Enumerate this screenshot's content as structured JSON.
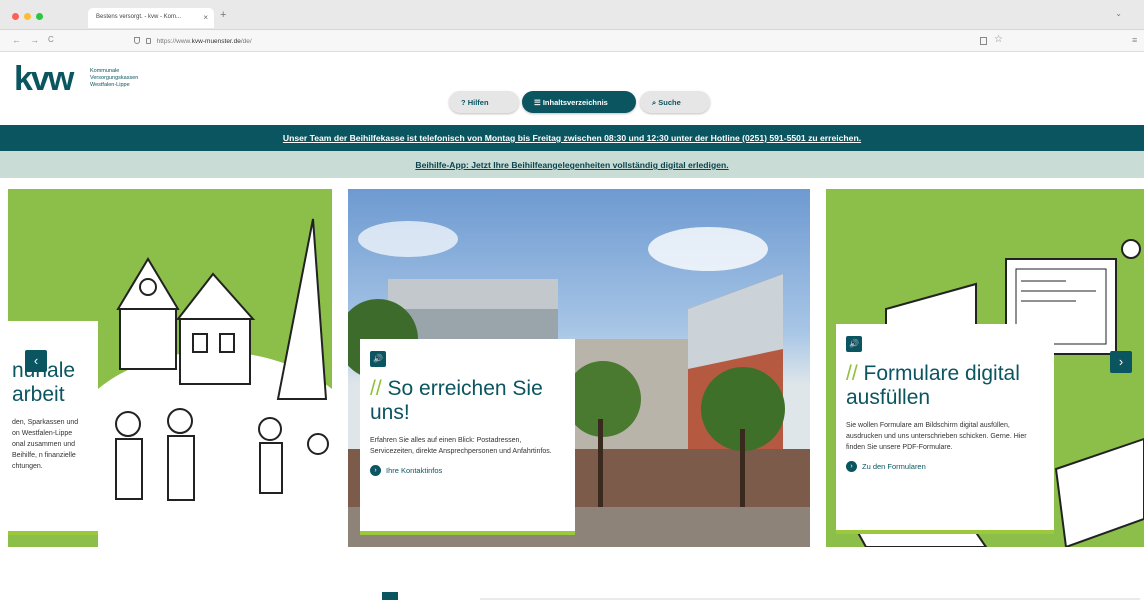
{
  "browser": {
    "tab_title": "Bestens versorgt. - kvw - Kom...",
    "tab_close": "×",
    "new_tab": "+",
    "tab_menu": "⌄",
    "back": "←",
    "forward": "→",
    "reload": "C",
    "url_prefix": "https://www.",
    "url_host": "kvw-muenster.de",
    "url_path": "/de/",
    "menu": "≡"
  },
  "logo": {
    "text": "kvw",
    "subline": "Kommunale Versorgungskassen Westfalen-Lippe"
  },
  "header_nav": [
    {
      "label": "Hilfen",
      "icon": "?"
    },
    {
      "label": "Inhaltsverzeichnis",
      "icon": "☰"
    },
    {
      "label": "Suche",
      "icon": "⌕"
    }
  ],
  "banner": {
    "hotline": "Unser Team der Beihilfekasse ist telefonisch von Montag bis Freitag zwischen 08:30 und 12:30 unter der Hotline (0251) 591-5501 zu erreichen.",
    "app": "Beihilfe-App: Jetzt Ihre Beihilfeangelegenheiten vollständig digital erledigen."
  },
  "slides": [
    {
      "title": "nunale arbeit",
      "text": "den, Sparkassen und on Westfalen-Lippe onal zusammen und Beihilfe, n finanzielle chtungen."
    },
    {
      "speaker": "🔊",
      "slash": "//",
      "title": " So erreichen Sie uns!",
      "text": "Erfahren Sie alles auf einen Blick: Postadressen, Servicezeiten, direkte Ansprechpersonen und Anfahrtinfos.",
      "link": "Ihre Kontaktinfos"
    },
    {
      "speaker": "🔊",
      "slash": "//",
      "title": " Formulare digital ausfüllen",
      "text": "Sie wollen Formulare am Bildschirm digital ausfüllen, ausdrucken und uns unterschrieben schicken. Gerne. Hier finden Sie unsere PDF-Formulare.",
      "link": "Zu den Formularen"
    }
  ],
  "carousel": {
    "prev": "‹",
    "next": "›"
  },
  "colors": {
    "brand": "#0b5560",
    "accent": "#8ec13a",
    "band_light": "#c9dcd6"
  }
}
